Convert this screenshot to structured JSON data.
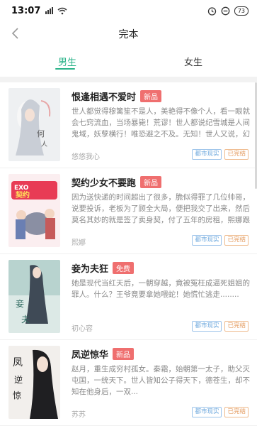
{
  "status_bar": {
    "time": "13:07",
    "battery": "73"
  },
  "nav": {
    "title": "完本"
  },
  "tabs": [
    {
      "label": "男生",
      "active": true
    },
    {
      "label": "女生",
      "active": false
    }
  ],
  "colors": {
    "accent": "#2bb389",
    "badge": "#ef6f6f",
    "genre_tag": "#6ea8dd",
    "status_tag": "#e3985a"
  },
  "books": [
    {
      "title": "恨逢相遇不爱时",
      "badge": "新品",
      "description": "世人都觉得穆篱笙不是人，美艳得不像个人，看一眼就会七窍流血，当场暴毙！荒谬！世人都说纪雪城是人间鬼域，妖孽横行！唯恐避之不及。无知！世人又说，幻雪...",
      "author": "悠悠我心",
      "genre": "都市现实",
      "status": "已完结"
    },
    {
      "title": "契约少女不要跑",
      "badge": "新品",
      "description": "因为送快递的时间超出了很多，脆似得罪了几位帅哥，说要投诉，老板为了顾全大局，便把我交了出来，然后莫名其妙的就是签了卖身契，付了五年的房租，熙娜跟我...",
      "author": "熙娜",
      "genre": "都市现实",
      "status": "已完结"
    },
    {
      "title": "妾为夫狂",
      "badge": "免费",
      "description": "她是现代当红天后，一朝穿越，竟被冤枉成逼死姐姐的罪人。什么？王爷竟要拿她喂蛇！她慌忙逃走........",
      "author": "初心容",
      "genre": "都市现实",
      "status": "已完结"
    },
    {
      "title": "凤逆惊华",
      "badge": "新品",
      "description": "赵月，重生成穷村孤女。秦霜，始朝第一太子，助父灭屯国，一统天下。世人皆知公子得天下，德苍生，却不知在他身后，一双...",
      "author": "苏苏",
      "genre": "都市现实",
      "status": "已完结"
    }
  ]
}
